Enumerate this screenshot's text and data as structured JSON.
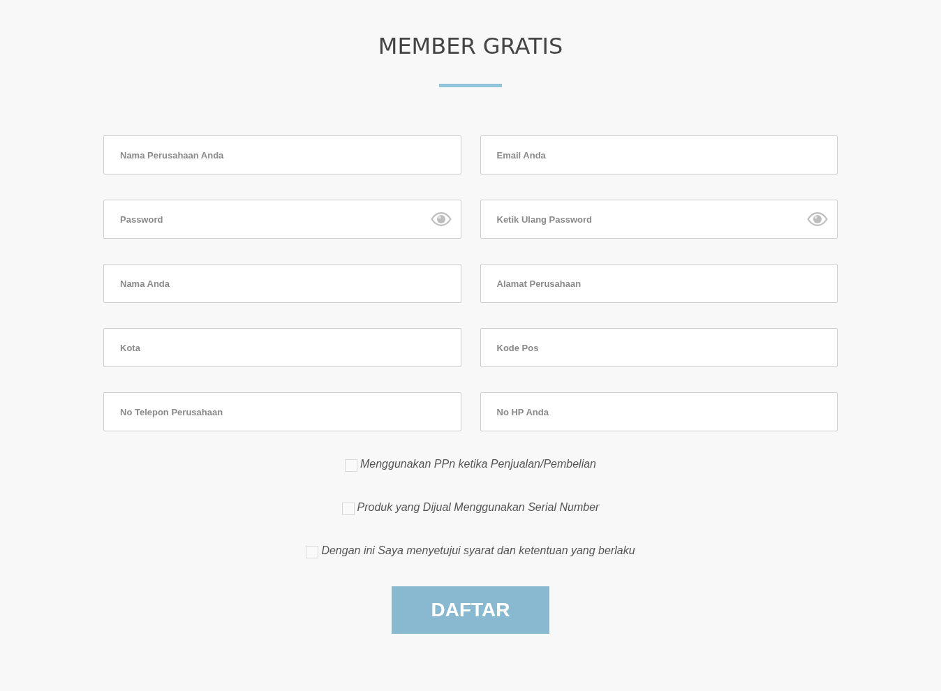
{
  "title": "MEMBER GRATIS",
  "fields": [
    {
      "kind": "text",
      "placeholder": "Nama Perusahaan Anda"
    },
    {
      "kind": "text",
      "placeholder": "Email Anda"
    },
    {
      "kind": "password",
      "placeholder": "Password"
    },
    {
      "kind": "password",
      "placeholder": "Ketik Ulang Password"
    },
    {
      "kind": "text",
      "placeholder": "Nama Anda"
    },
    {
      "kind": "text",
      "placeholder": "Alamat Perusahaan"
    },
    {
      "kind": "text",
      "placeholder": "Kota"
    },
    {
      "kind": "text",
      "placeholder": "Kode Pos"
    },
    {
      "kind": "text",
      "placeholder": "No Telepon Perusahaan"
    },
    {
      "kind": "text",
      "placeholder": "No HP Anda"
    }
  ],
  "checkboxes": [
    {
      "label": "Menggunakan PPn ketika Penjualan/Pembelian",
      "checked": false
    },
    {
      "label": "Produk yang Dijual Menggunakan Serial Number",
      "checked": false
    },
    {
      "label": "Dengan ini Saya menyetujui syarat dan ketentuan yang berlaku",
      "checked": false
    }
  ],
  "submit_button": "DAFTAR"
}
